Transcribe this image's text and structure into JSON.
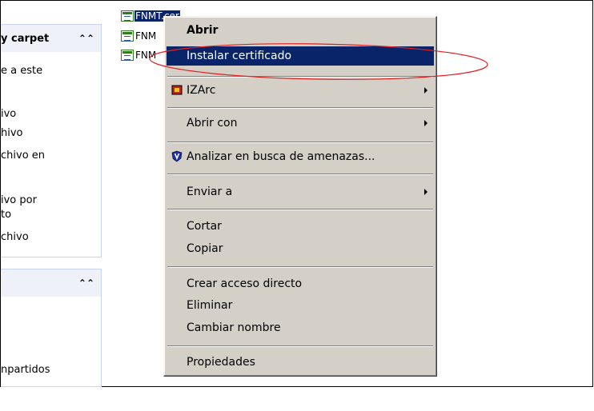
{
  "left_pane": {
    "section1": {
      "title": "y carpet",
      "lines": [
        "e a este",
        "ivo",
        "hivo",
        "chivo en",
        "ivo por",
        "to",
        "chivo"
      ]
    },
    "section2": {
      "lines": [
        "npartidos"
      ]
    }
  },
  "files": [
    {
      "label": "FNMT.cer"
    },
    {
      "label": "FNM"
    },
    {
      "label": "FNM"
    }
  ],
  "menu": {
    "items": [
      {
        "label": "Abrir"
      },
      {
        "label": "Instalar certificado"
      },
      {
        "label": "IZArc"
      },
      {
        "label": "Abrir con"
      },
      {
        "label": "Analizar en busca de amenazas..."
      },
      {
        "label": "Enviar a"
      },
      {
        "label": "Cortar"
      },
      {
        "label": "Copiar"
      },
      {
        "label": "Crear acceso directo"
      },
      {
        "label": "Eliminar"
      },
      {
        "label": "Cambiar nombre"
      },
      {
        "label": "Propiedades"
      }
    ]
  },
  "colors": {
    "selection": "#0a246a",
    "menu_bg": "#d4d0c8",
    "annotation": "#e02020"
  }
}
